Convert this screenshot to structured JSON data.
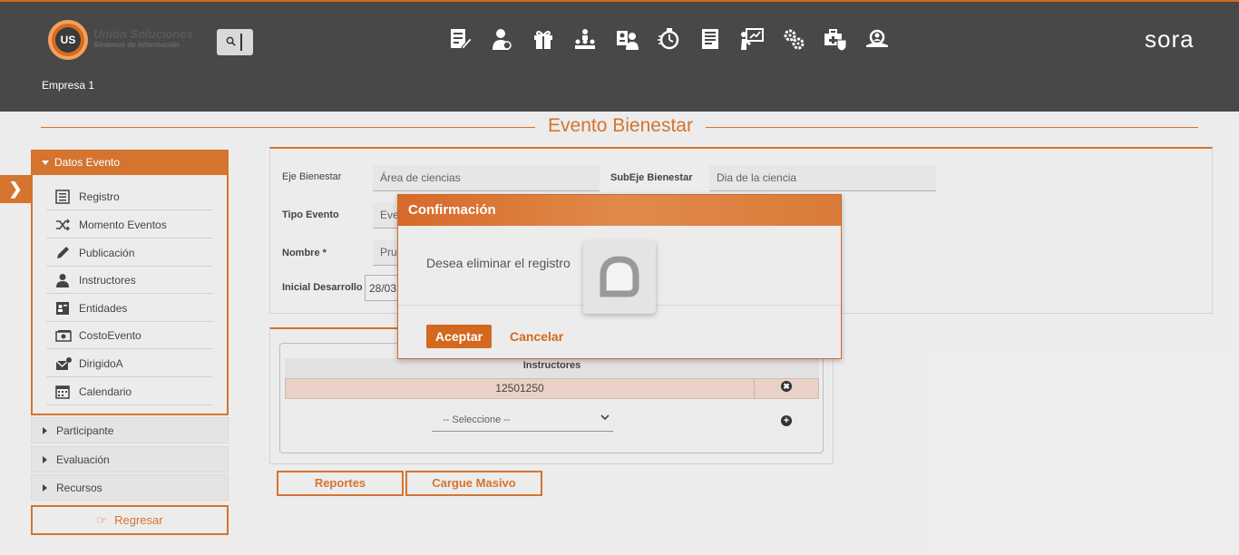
{
  "header": {
    "brand_name": "Unión Soluciones",
    "brand_sub": "Sistemas de Información",
    "logo_initials": "US",
    "company": "Empresa 1",
    "app_logo": "sora",
    "nav_icons": [
      "edit-doc-icon",
      "person-icon",
      "gift-icon",
      "org-chart-icon",
      "user-card-icon",
      "stopwatch-icon",
      "document-list-icon",
      "presentation-icon",
      "gears-icon",
      "medical-kit-icon",
      "search-user-icon"
    ]
  },
  "page_title": "Evento Bienestar",
  "sidebar": {
    "section_title": "Datos Evento",
    "items": [
      {
        "label": "Registro",
        "icon": "list-icon"
      },
      {
        "label": "Momento Eventos",
        "icon": "shuffle-icon"
      },
      {
        "label": "Publicación",
        "icon": "pencil-icon"
      },
      {
        "label": "Instructores",
        "icon": "user-icon"
      },
      {
        "label": "Entidades",
        "icon": "id-card-icon"
      },
      {
        "label": "CostoEvento",
        "icon": "money-icon"
      },
      {
        "label": "DirigidoA",
        "icon": "mail-icon"
      },
      {
        "label": "Calendario",
        "icon": "calendar-icon"
      }
    ],
    "accordions": [
      "Participante",
      "Evaluación",
      "Recursos"
    ],
    "back_label": "Regresar"
  },
  "form": {
    "eje_label": "Eje Bienestar",
    "eje_value": "Área de ciencias",
    "subeje_label": "SubEje Bienestar",
    "subeje_value": "Dia de la ciencia",
    "tipo_label": "Tipo Evento",
    "tipo_value": "Eve",
    "nombre_label": "Nombre *",
    "nombre_value": "Pru",
    "inicial_label": "Inicial Desarrollo",
    "inicial_value": "28/03"
  },
  "instructors": {
    "column": "Instructores",
    "rows": [
      "12501250"
    ],
    "select_value": "-- Seleccione --"
  },
  "buttons": {
    "reportes": "Reportes",
    "cargue": "Cargue Masivo"
  },
  "modal": {
    "title": "Confirmación",
    "message": "Desea eliminar el registro",
    "accept": "Aceptar",
    "cancel": "Cancelar"
  },
  "colors": {
    "accent": "#d2691e",
    "header": "#484848",
    "background": "#ebebeb"
  }
}
